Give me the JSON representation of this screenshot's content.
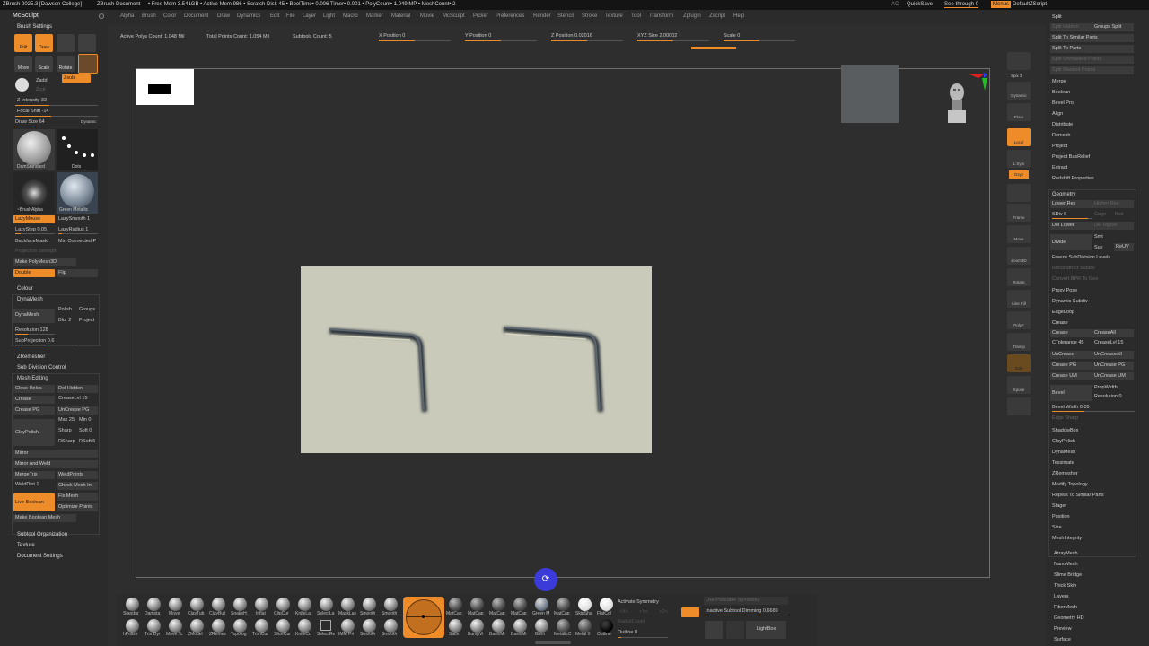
{
  "titlebar": {
    "app": "ZBrush 2025.3 [Dawson College]",
    "doc": "ZBrush Document",
    "stats": "• Free Mem 3.541GB • Active Mem 986 • Scratch Disk 45 • BoolTime• 0.006 Timer• 0.001 • PolyCount• 1.049 MP • MeshCount• 2",
    "ac": "AC",
    "quicksave": "QuickSave",
    "seethrough": "See-through  0",
    "menus": "Menus",
    "zscript": "DefaultZScript"
  },
  "menubar": [
    "Alpha",
    "Brush",
    "Color",
    "Document",
    "Draw",
    "Dynamics",
    "Edit",
    "File",
    "Layer",
    "Light",
    "Macro",
    "Marker",
    "Material",
    "Movie",
    "McSculpt",
    "Picker",
    "Preferences",
    "Render",
    "Stencil",
    "Stroke",
    "Texture",
    "Tool",
    "Transform",
    "Zplugin",
    "Zscript",
    "Help"
  ],
  "left": {
    "title": "McSculpt",
    "brush_settings": "Brush Settings",
    "edit": "Edit",
    "draw": "Draw",
    "move": "Move",
    "scale": "Scale",
    "rotate": "Rotate",
    "zadd": "Zadd",
    "zsub": "Zsub",
    "zcut": "Zcut",
    "z_intensity": "Z Intensity 33",
    "focal_shift": "Focal Shift -14",
    "draw_size": "Draw Size 64",
    "dynamic": "Dynamic",
    "brush1": "DamStandard",
    "brush2": "Dots",
    "brush3": "~BrushAlpha",
    "brush4": "Green Metallic",
    "lazymouse": "LazyMouse",
    "lazysmooth": "LazySmooth 1",
    "lazystep": "LazyStep 0.05",
    "lazyradius": "LazyRadius 1",
    "backfacemask": "BackfaceMask",
    "minconnected": "Min Connected P",
    "projection": "Projection Strength",
    "make_polymesh": "Make PolyMesh3D",
    "double": "Double",
    "flip": "Flip",
    "colour": "Colour",
    "dynamesh": "DynaMesh",
    "dynamesh_btn": "DynaMesh",
    "polish": "Polish",
    "groups": "Groups",
    "blur": "Blur 2",
    "project": "Project",
    "resolution": "Resolution 128",
    "subprojection": "SubProjection 0.6",
    "zremesher": "ZRemesher",
    "subdivision": "Sub Division Control",
    "mesh_editing": "Mesh Editing",
    "close_holes": "Close Holes",
    "del_hidden": "Del Hidden",
    "crease": "Crease",
    "creaselvl": "CreaseLvl 15",
    "crease_pg": "Crease PG",
    "uncrease_pg": "UnCrease PG",
    "claypolish": "ClayPolish",
    "max": "Max 25",
    "min": "Min 0",
    "sharp": "Sharp",
    "soft": "Soft 0",
    "rsharp": "RSharp",
    "rsoft": "RSoft 5",
    "mirror": "Mirror",
    "mirror_weld": "Mirror And Weld",
    "mergetris": "MergeTris",
    "weldpoints": "WeldPoints",
    "welddist": "WeldDist 1",
    "check_mesh": "Check Mesh Int",
    "fix_mesh": "Fix Mesh",
    "live_boolean": "Live Boolean",
    "optimize": "Optimize Points",
    "make_boolean": "Make Boolean Mesh",
    "subtool_org": "Subtool Organization",
    "texture": "Texture",
    "doc_settings": "Document Settings"
  },
  "status": {
    "active_polys": "Active Polys Count: 1.048 Mil",
    "total_points": "Total Points Count: 1.054 Mil",
    "subtools": "Subtools Count: 5",
    "xpos": "X Position  0",
    "ypos": "Y Position  0",
    "zpos": "Z Position  0.02016",
    "xyz": "XYZ Size  2.00002",
    "scale": "Scale  0"
  },
  "righttool": [
    "Spix 3",
    "Dynamic",
    "Persp",
    "Floor",
    "Local",
    "L.Sym",
    "Gxyz",
    "Frame",
    "Move",
    "Zoom3D",
    "Rotate",
    "Line Fill",
    "PolyF",
    "Transp",
    "Solo",
    "Xpose"
  ],
  "right": {
    "split_header": "Split",
    "split_hidden": "Split Hidden",
    "groups_split": "Groups Split",
    "split_similar": "Split To Similar Parts",
    "split_parts": "Split To Parts",
    "split_unmasked": "Split Unmasked Points",
    "split_masked": "Split Masked Points",
    "merge": "Merge",
    "boolean": "Boolean",
    "bevel_pro": "Bevel Pro",
    "align": "Align",
    "distribute": "Distribute",
    "remesh": "Remesh",
    "project": "Project",
    "project_basrelief": "Project BasRelief",
    "extract": "Extract",
    "redshift": "Redshift Properties",
    "geometry": "Geometry",
    "lower_res": "Lower Res",
    "higher_res": "Higher Res",
    "sdiv": "SDiv 6",
    "cage": "Cage",
    "rstr": "Rstr",
    "del_lower": "Del Lower",
    "del_higher": "Del Higher",
    "divide": "Divide",
    "smt": "Smt",
    "suv": "Suv",
    "reuv": "ReUV",
    "freeze": "Freeze SubDivision Levels",
    "reconstruct": "Reconstruct Subdiv",
    "convert_bpr": "Convert BPR To Geo",
    "proxy_pose": "Proxy Pose",
    "dynamic_subdiv": "Dynamic Subdiv",
    "edgeloop": "EdgeLoop",
    "crease_header": "Crease",
    "crease": "Crease",
    "creaseall": "CreaseAll",
    "ctolerance": "CTolerance 45",
    "creaselvl": "CreaseLvl 15",
    "uncrease": "UnCrease",
    "uncreaseall": "UnCreaseAll",
    "crease_pg": "Crease PG",
    "uncrease_pg": "UnCrease PG",
    "crease_um": "Crease UM",
    "uncrease_um": "UnCrease UM",
    "bevel": "Bevel",
    "propwidth": "PropWidth",
    "resolution": "Resolution 0",
    "bevel_width": "Bevel Width 0.05",
    "edge_sharp": "Edge Sharp",
    "shadowbox": "ShadowBox",
    "claypolish": "ClayPolish",
    "dynamesh": "DynaMesh",
    "tessimate": "Tessimate",
    "zremesher": "ZRemesher",
    "modify_topology": "Modify Topology",
    "repeat_similar": "Repeat To Similar Parts",
    "stager": "Stager",
    "position": "Position",
    "size": "Size",
    "meshintegrity": "MeshIntegrity",
    "arraymesh": "ArrayMesh",
    "nanomesh": "NanoMesh",
    "slime": "Slime Bridge",
    "thickskin": "Thick Skin",
    "layers": "Layers",
    "fibermesh": "FiberMesh",
    "geometryhd": "Geometry HD",
    "preview": "Preview",
    "surface": "Surface"
  },
  "bottom": {
    "row1": [
      "Standar",
      "Damsta",
      "Move",
      "ClayTub",
      "ClayBuil",
      "SnakeH",
      "Inflat",
      "ClipCur",
      "KnifeLa",
      "SelectLa",
      "MaskLas",
      "Smooth",
      "Smooth"
    ],
    "row2": [
      "hPolish",
      "TrimDyr",
      "Move Tc",
      "ZModel",
      "ZRemes",
      "Topolog",
      "TrimCur",
      "SliceCur",
      "KnifeCu",
      "SelectRe",
      "IMM Pri",
      "Smooth",
      "Smooth"
    ],
    "mats1": [
      "MatCap",
      "MatCap",
      "MatCap",
      "MatCap",
      "Green M",
      "MatCap",
      "SkinSha",
      "FlatCol"
    ],
    "mats2": [
      "Satin",
      "BumpVi",
      "BasicMi",
      "BasicMi",
      "Blinn",
      "MetalicC",
      "Metal 0",
      "Outline"
    ],
    "activate_symmetry": "Activate Symmetry",
    "use_poseable": "Use Poseable Symmetry",
    "inactive_dimming": "Inactive Subtool Dimming  0.6689",
    "radial_count": "RadialCount",
    "outline": "Outline  0",
    "lightbox": "LightBox"
  },
  "colors": {
    "accent": "#ee8c2a",
    "panel": "#2b2b2b",
    "viewport": "#2e2e2e",
    "gizmo_blue": "#3b3bd9"
  }
}
